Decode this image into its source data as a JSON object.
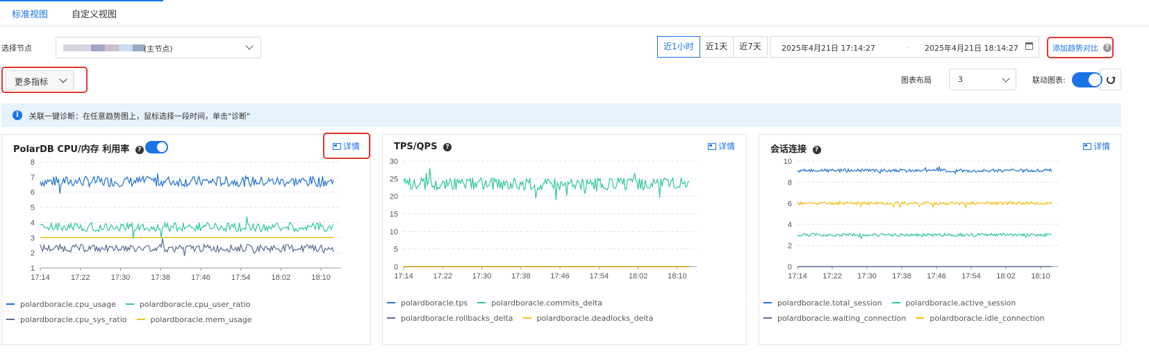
{
  "tabs": [
    {
      "label": "标准视图",
      "active": true
    },
    {
      "label": "自定义视图",
      "active": false
    }
  ],
  "toolbar": {
    "node_label": "选择节点",
    "node_value": "(主节点)",
    "time_ranges": [
      {
        "label": "近1小时",
        "active": true
      },
      {
        "label": "近1天",
        "active": false
      },
      {
        "label": "近7天",
        "active": false
      }
    ],
    "start_time": "2025年4月21日 17:14:27",
    "range_separator": "-",
    "end_time": "2025年4月21日 18:14:27",
    "add_trend_label": "添加趋势对比",
    "more_metrics_label": "更多指标",
    "layout_label": "图表布局",
    "layout_value": "3",
    "linked_label": "联动图表:",
    "linked_on": true
  },
  "notice": {
    "text": "关联一键诊断：在任意趋势图上，鼠标选择一段时间，单击\"诊断\""
  },
  "detail_label": "详情",
  "colors": {
    "accent": "#1a73e8",
    "highlight": "#e0362c",
    "blue": "#1f6fd0",
    "green": "#2ec79a",
    "slate": "#5b6b8f",
    "yellow": "#f2c118"
  },
  "chart_data": [
    {
      "type": "line",
      "title": "PolarDB CPU/内存 利用率",
      "toggle_on": true,
      "x": [
        "17:14",
        "17:22",
        "17:30",
        "17:38",
        "17:46",
        "17:54",
        "18:02",
        "18:10"
      ],
      "xlim": [
        "17:14",
        "18:14"
      ],
      "ylim": [
        1,
        8
      ],
      "yticks": [
        1,
        2,
        3,
        4,
        5,
        6,
        7,
        8
      ],
      "grid": true,
      "series": [
        {
          "name": "polardboracle.cpu_usage",
          "color": "#1f6fd0",
          "mean": 6.7,
          "noise": 0.35
        },
        {
          "name": "polardboracle.cpu_user_ratio",
          "color": "#2ec79a",
          "mean": 3.7,
          "noise": 0.3
        },
        {
          "name": "polardboracle.cpu_sys_ratio",
          "color": "#5b6b8f",
          "mean": 2.3,
          "noise": 0.25
        },
        {
          "name": "polardboracle.mem_usage",
          "color": "#f2c118",
          "mean": 3.0,
          "noise": 0
        }
      ]
    },
    {
      "type": "line",
      "title": "TPS/QPS",
      "x": [
        "17:14",
        "17:22",
        "17:30",
        "17:38",
        "17:46",
        "17:54",
        "18:02",
        "18:10"
      ],
      "xlim": [
        "17:14",
        "18:14"
      ],
      "ylim": [
        0,
        30
      ],
      "yticks": [
        0,
        5,
        10,
        15,
        20,
        25,
        30
      ],
      "grid": true,
      "series": [
        {
          "name": "polardboracle.tps",
          "color": "#1f6fd0",
          "mean": 0,
          "noise": 0
        },
        {
          "name": "polardboracle.commits_delta",
          "color": "#2ec79a",
          "mean": 23.5,
          "noise": 1.8
        },
        {
          "name": "polardboracle.rollbacks_delta",
          "color": "#5b6b8f",
          "mean": 0,
          "noise": 0
        },
        {
          "name": "polardboracle.deadlocks_delta",
          "color": "#f2c118",
          "mean": 0,
          "noise": 0
        }
      ]
    },
    {
      "type": "line",
      "title": "会话连接",
      "x": [
        "17:14",
        "17:22",
        "17:30",
        "17:38",
        "17:46",
        "17:54",
        "18:02",
        "18:10"
      ],
      "xlim": [
        "17:14",
        "18:14"
      ],
      "ylim": [
        0,
        10
      ],
      "yticks": [
        0,
        2,
        4,
        6,
        8,
        10
      ],
      "grid": true,
      "series": [
        {
          "name": "polardboracle.total_session",
          "color": "#1f6fd0",
          "mean": 9.1,
          "noise": 0.15
        },
        {
          "name": "polardboracle.active_session",
          "color": "#2ec79a",
          "mean": 3.0,
          "noise": 0.15
        },
        {
          "name": "polardboracle.waiting_connection",
          "color": "#5b6b8f",
          "mean": 0,
          "noise": 0
        },
        {
          "name": "polardboracle.idle_connection",
          "color": "#f2c118",
          "mean": 6.0,
          "noise": 0.15
        }
      ]
    }
  ]
}
